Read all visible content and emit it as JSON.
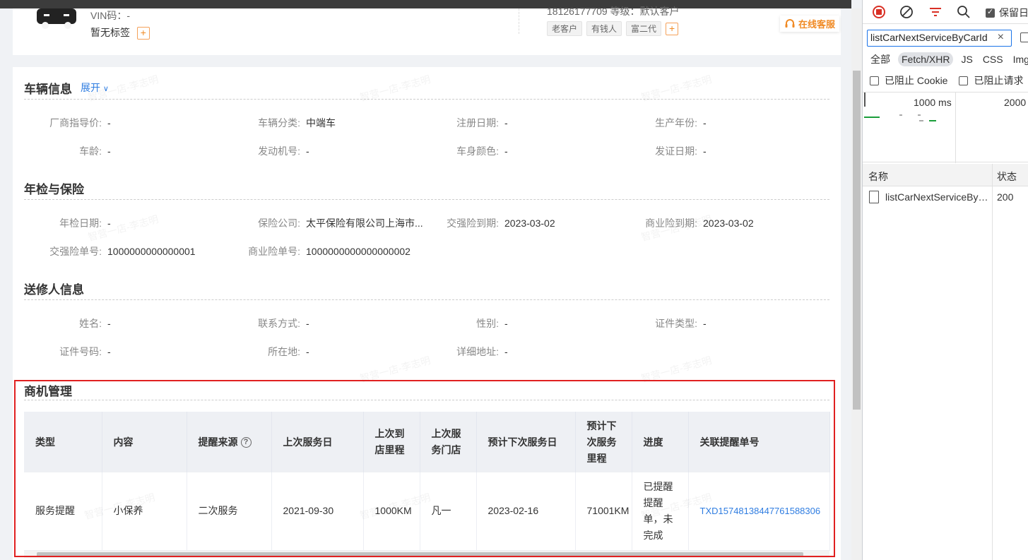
{
  "header": {
    "vin_label": "VIN码：-",
    "no_tags": "暂无标签",
    "plus": "+",
    "phone_line": "18126177709     等级：默认客户",
    "tags": [
      "老客户",
      "有钱人",
      "富二代"
    ],
    "online_service": "在线客服"
  },
  "watermark_text": "智营一店-李志明",
  "vehicle": {
    "title": "车辆信息",
    "expand": "展开",
    "fields": [
      {
        "label": "厂商指导价:",
        "value": "-"
      },
      {
        "label": "车辆分类:",
        "value": "中端车"
      },
      {
        "label": "注册日期:",
        "value": "-"
      },
      {
        "label": "生产年份:",
        "value": "-"
      },
      {
        "label": "车龄:",
        "value": "-"
      },
      {
        "label": "发动机号:",
        "value": "-"
      },
      {
        "label": "车身颜色:",
        "value": "-"
      },
      {
        "label": "发证日期:",
        "value": "-"
      }
    ]
  },
  "inspection": {
    "title": "年检与保险",
    "fields": [
      {
        "label": "年检日期:",
        "value": "-"
      },
      {
        "label": "保险公司:",
        "value": "太平保险有限公司上海市..."
      },
      {
        "label": "交强险到期:",
        "value": "2023-03-02"
      },
      {
        "label": "商业险到期:",
        "value": "2023-03-02"
      },
      {
        "label": "交强险单号:",
        "value": "1000000000000001"
      },
      {
        "label": "商业险单号:",
        "value": "1000000000000000002"
      }
    ]
  },
  "sender": {
    "title": "送修人信息",
    "fields": [
      {
        "label": "姓名:",
        "value": "-"
      },
      {
        "label": "联系方式:",
        "value": "-"
      },
      {
        "label": "性别:",
        "value": "-"
      },
      {
        "label": "证件类型:",
        "value": "-"
      },
      {
        "label": "证件号码:",
        "value": "-"
      },
      {
        "label": "所在地:",
        "value": "-"
      },
      {
        "label": "详细地址:",
        "value": "-"
      }
    ]
  },
  "business": {
    "title": "商机管理",
    "columns": [
      "类型",
      "内容",
      "提醒来源",
      "上次服务日",
      "上次到店里程",
      "上次服务门店",
      "预计下次服务日",
      "预计下次服务里程",
      "进度",
      "关联提醒单号"
    ],
    "help_icon": "?",
    "row": {
      "type": "服务提醒",
      "content": "小保养",
      "source": "二次服务",
      "last_date": "2021-09-30",
      "last_mileage": "1000KM",
      "last_store": "凡一",
      "next_date": "2023-02-16",
      "next_mileage": "71001KM",
      "progress": "已提醒提醒单，未完成",
      "reminder_no": "TXD15748138447761588306"
    }
  },
  "devtools": {
    "preserve_log": "保留日",
    "filter_value": "listCarNextServiceByCarId",
    "filter_clear": "×",
    "types": [
      "全部",
      "Fetch/XHR",
      "JS",
      "CSS",
      "Img"
    ],
    "blocked_cookies": "已阻止 Cookie",
    "blocked_requests": "已阻止请求",
    "tick1": "1000 ms",
    "tick2": "2000",
    "col_name": "名称",
    "col_status": "状态",
    "request_name": "listCarNextServiceByCarId",
    "request_status": "200"
  },
  "colors": {
    "accent": "#2f7de1",
    "warning": "#f08a24",
    "highlight_box": "#e02020",
    "record": "#d93025"
  }
}
